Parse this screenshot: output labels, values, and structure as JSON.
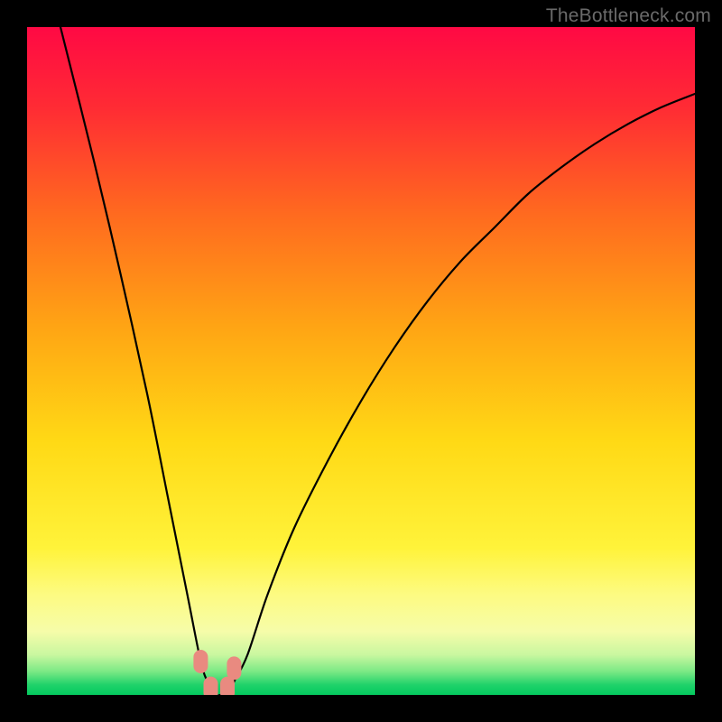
{
  "watermark": "TheBottleneck.com",
  "chart_data": {
    "type": "line",
    "title": "",
    "xlabel": "",
    "ylabel": "",
    "xlim": [
      0,
      100
    ],
    "ylim": [
      0,
      100
    ],
    "grid": false,
    "legend": false,
    "series": [
      {
        "name": "bottleneck-curve",
        "color": "#000000",
        "x": [
          5,
          10,
          14,
          18,
          21,
          24,
          26,
          27,
          28,
          29,
          30,
          31,
          33,
          36,
          40,
          45,
          50,
          55,
          60,
          65,
          70,
          75,
          80,
          85,
          90,
          95,
          100
        ],
        "y": [
          100,
          80,
          63,
          45,
          30,
          15,
          5,
          2,
          0,
          0,
          0,
          2,
          6,
          15,
          25,
          35,
          44,
          52,
          59,
          65,
          70,
          75,
          79,
          82.5,
          85.5,
          88,
          90
        ]
      }
    ],
    "markers": [
      {
        "name": "pill-left-upper",
        "x": 26.0,
        "y": 5.0,
        "shape": "pill",
        "color": "#e98a80"
      },
      {
        "name": "pill-left-lower",
        "x": 27.5,
        "y": 1.0,
        "shape": "pill",
        "color": "#e98a80"
      },
      {
        "name": "pill-right-upper",
        "x": 31.0,
        "y": 4.0,
        "shape": "pill",
        "color": "#e98a80"
      },
      {
        "name": "pill-right-lower",
        "x": 30.0,
        "y": 1.0,
        "shape": "pill",
        "color": "#e98a80"
      }
    ],
    "background_gradient": {
      "type": "vertical",
      "stops": [
        {
          "offset": 0.0,
          "color": "#ff0944"
        },
        {
          "offset": 0.12,
          "color": "#ff2b34"
        },
        {
          "offset": 0.28,
          "color": "#ff6a1f"
        },
        {
          "offset": 0.45,
          "color": "#ffa514"
        },
        {
          "offset": 0.62,
          "color": "#ffd915"
        },
        {
          "offset": 0.78,
          "color": "#fff33a"
        },
        {
          "offset": 0.85,
          "color": "#fdfb82"
        },
        {
          "offset": 0.905,
          "color": "#f6fca9"
        },
        {
          "offset": 0.94,
          "color": "#c9f7a0"
        },
        {
          "offset": 0.965,
          "color": "#7be985"
        },
        {
          "offset": 0.985,
          "color": "#1fd26a"
        },
        {
          "offset": 1.0,
          "color": "#04c95f"
        }
      ]
    }
  }
}
